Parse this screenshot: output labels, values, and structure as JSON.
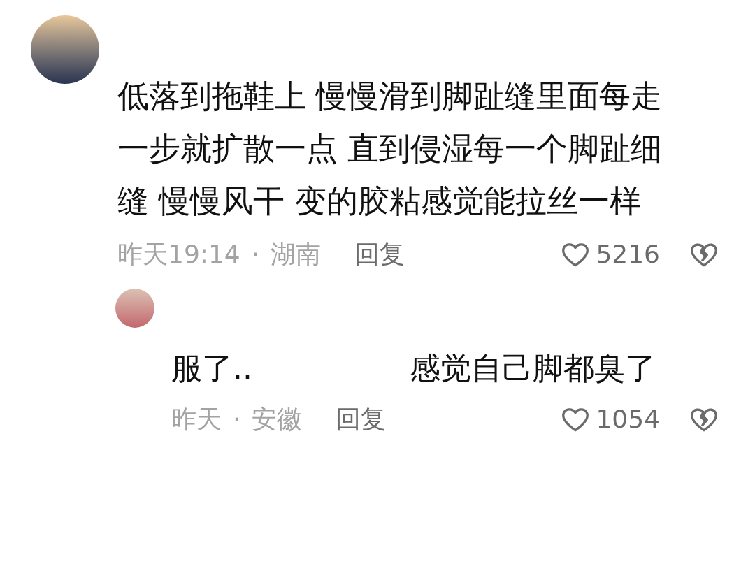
{
  "comment": {
    "text": "低落到拖鞋上 慢慢滑到脚趾缝里面每走一步就扩散一点 直到侵湿每一个脚趾细缝 慢慢风干 变的胶粘感觉能拉丝一样",
    "time": "昨天19:14",
    "separator": "·",
    "location": "湖南",
    "reply_label": "回复",
    "likes": "5216",
    "replies": [
      {
        "text_parts": [
          "服了..",
          "感觉自己脚都臭了"
        ],
        "time": "昨天",
        "separator": "·",
        "location": "安徽",
        "reply_label": "回复",
        "likes": "1054"
      }
    ]
  }
}
